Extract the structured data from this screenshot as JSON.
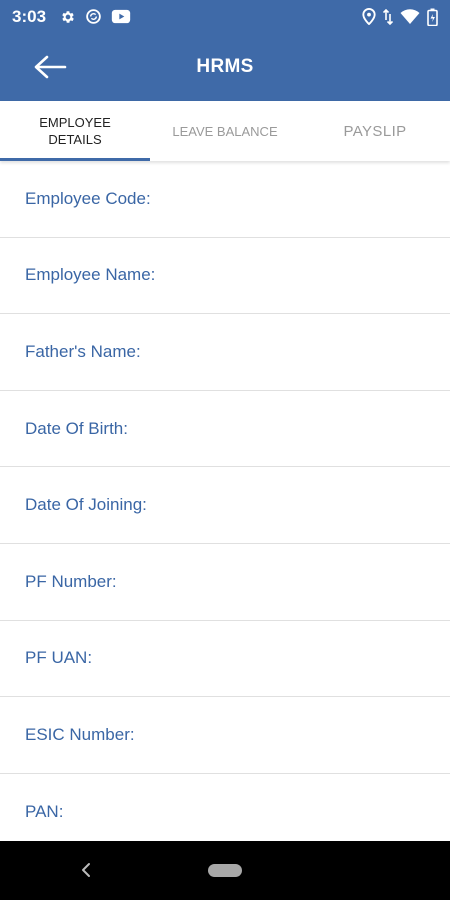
{
  "status_bar": {
    "time": "3:03",
    "left_icons": [
      "gear-icon",
      "sync-icon",
      "youtube-icon"
    ],
    "right_icons": [
      "location-icon",
      "data-arrows-icon",
      "wifi-icon",
      "battery-icon"
    ]
  },
  "app_bar": {
    "title": "HRMS",
    "back_icon": "arrow-left-icon"
  },
  "tabs": [
    {
      "label": "EMPLOYEE DETAILS",
      "active": true
    },
    {
      "label": "LEAVE BALANCE",
      "active": false
    },
    {
      "label": "PAYSLIP",
      "active": false
    }
  ],
  "fields": [
    {
      "label": "Employee Code:"
    },
    {
      "label": "Employee Name:"
    },
    {
      "label": "Father's Name:"
    },
    {
      "label": "Date Of Birth:"
    },
    {
      "label": "Date Of Joining:"
    },
    {
      "label": "PF Number:"
    },
    {
      "label": "PF UAN:"
    },
    {
      "label": "ESIC Number:"
    },
    {
      "label": "PAN:"
    }
  ],
  "colors": {
    "primary": "#3f6aa8",
    "label_text": "#3a66a5",
    "inactive_tab": "#9a9a9a"
  }
}
